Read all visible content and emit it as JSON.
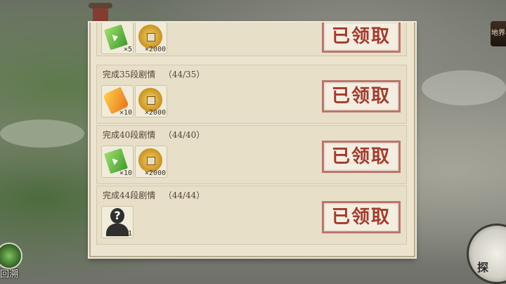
{
  "game": {
    "left_button_label": "回溯",
    "right_top_label": "地界",
    "right_button_label": "探"
  },
  "quests": [
    {
      "title": "",
      "rewards": [
        {
          "icon": "green-ticket-icon",
          "qty": "×5"
        },
        {
          "icon": "coin-icon",
          "qty": "×2000"
        }
      ],
      "status": "已领取"
    },
    {
      "title": "完成35段剧情   （44/35）",
      "rewards": [
        {
          "icon": "scroll-icon",
          "qty": "×10"
        },
        {
          "icon": "coin-icon",
          "qty": "×2000"
        }
      ],
      "status": "已领取"
    },
    {
      "title": "完成40段剧情   （44/40）",
      "rewards": [
        {
          "icon": "green-ticket-icon",
          "qty": "×10"
        },
        {
          "icon": "coin-icon",
          "qty": "×2000"
        }
      ],
      "status": "已领取"
    },
    {
      "title": "完成44段剧情   （44/44）",
      "rewards": [
        {
          "icon": "unknown-avatar-icon",
          "qty": "×1"
        }
      ],
      "status": "已领取"
    }
  ],
  "colors": {
    "claimed_text": "#a23b2d",
    "panel_bg": "#ece4cf"
  }
}
